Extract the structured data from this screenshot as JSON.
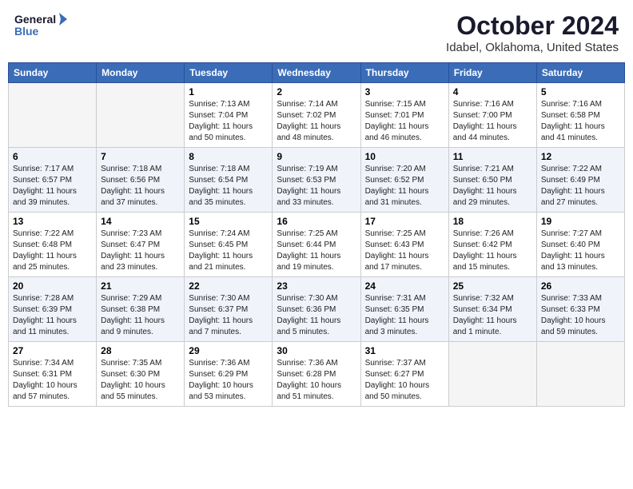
{
  "header": {
    "logo_line1": "General",
    "logo_line2": "Blue",
    "month": "October 2024",
    "location": "Idabel, Oklahoma, United States"
  },
  "weekdays": [
    "Sunday",
    "Monday",
    "Tuesday",
    "Wednesday",
    "Thursday",
    "Friday",
    "Saturday"
  ],
  "weeks": [
    [
      {
        "day": "",
        "info": ""
      },
      {
        "day": "",
        "info": ""
      },
      {
        "day": "1",
        "info": "Sunrise: 7:13 AM\nSunset: 7:04 PM\nDaylight: 11 hours and 50 minutes."
      },
      {
        "day": "2",
        "info": "Sunrise: 7:14 AM\nSunset: 7:02 PM\nDaylight: 11 hours and 48 minutes."
      },
      {
        "day": "3",
        "info": "Sunrise: 7:15 AM\nSunset: 7:01 PM\nDaylight: 11 hours and 46 minutes."
      },
      {
        "day": "4",
        "info": "Sunrise: 7:16 AM\nSunset: 7:00 PM\nDaylight: 11 hours and 44 minutes."
      },
      {
        "day": "5",
        "info": "Sunrise: 7:16 AM\nSunset: 6:58 PM\nDaylight: 11 hours and 41 minutes."
      }
    ],
    [
      {
        "day": "6",
        "info": "Sunrise: 7:17 AM\nSunset: 6:57 PM\nDaylight: 11 hours and 39 minutes."
      },
      {
        "day": "7",
        "info": "Sunrise: 7:18 AM\nSunset: 6:56 PM\nDaylight: 11 hours and 37 minutes."
      },
      {
        "day": "8",
        "info": "Sunrise: 7:18 AM\nSunset: 6:54 PM\nDaylight: 11 hours and 35 minutes."
      },
      {
        "day": "9",
        "info": "Sunrise: 7:19 AM\nSunset: 6:53 PM\nDaylight: 11 hours and 33 minutes."
      },
      {
        "day": "10",
        "info": "Sunrise: 7:20 AM\nSunset: 6:52 PM\nDaylight: 11 hours and 31 minutes."
      },
      {
        "day": "11",
        "info": "Sunrise: 7:21 AM\nSunset: 6:50 PM\nDaylight: 11 hours and 29 minutes."
      },
      {
        "day": "12",
        "info": "Sunrise: 7:22 AM\nSunset: 6:49 PM\nDaylight: 11 hours and 27 minutes."
      }
    ],
    [
      {
        "day": "13",
        "info": "Sunrise: 7:22 AM\nSunset: 6:48 PM\nDaylight: 11 hours and 25 minutes."
      },
      {
        "day": "14",
        "info": "Sunrise: 7:23 AM\nSunset: 6:47 PM\nDaylight: 11 hours and 23 minutes."
      },
      {
        "day": "15",
        "info": "Sunrise: 7:24 AM\nSunset: 6:45 PM\nDaylight: 11 hours and 21 minutes."
      },
      {
        "day": "16",
        "info": "Sunrise: 7:25 AM\nSunset: 6:44 PM\nDaylight: 11 hours and 19 minutes."
      },
      {
        "day": "17",
        "info": "Sunrise: 7:25 AM\nSunset: 6:43 PM\nDaylight: 11 hours and 17 minutes."
      },
      {
        "day": "18",
        "info": "Sunrise: 7:26 AM\nSunset: 6:42 PM\nDaylight: 11 hours and 15 minutes."
      },
      {
        "day": "19",
        "info": "Sunrise: 7:27 AM\nSunset: 6:40 PM\nDaylight: 11 hours and 13 minutes."
      }
    ],
    [
      {
        "day": "20",
        "info": "Sunrise: 7:28 AM\nSunset: 6:39 PM\nDaylight: 11 hours and 11 minutes."
      },
      {
        "day": "21",
        "info": "Sunrise: 7:29 AM\nSunset: 6:38 PM\nDaylight: 11 hours and 9 minutes."
      },
      {
        "day": "22",
        "info": "Sunrise: 7:30 AM\nSunset: 6:37 PM\nDaylight: 11 hours and 7 minutes."
      },
      {
        "day": "23",
        "info": "Sunrise: 7:30 AM\nSunset: 6:36 PM\nDaylight: 11 hours and 5 minutes."
      },
      {
        "day": "24",
        "info": "Sunrise: 7:31 AM\nSunset: 6:35 PM\nDaylight: 11 hours and 3 minutes."
      },
      {
        "day": "25",
        "info": "Sunrise: 7:32 AM\nSunset: 6:34 PM\nDaylight: 11 hours and 1 minute."
      },
      {
        "day": "26",
        "info": "Sunrise: 7:33 AM\nSunset: 6:33 PM\nDaylight: 10 hours and 59 minutes."
      }
    ],
    [
      {
        "day": "27",
        "info": "Sunrise: 7:34 AM\nSunset: 6:31 PM\nDaylight: 10 hours and 57 minutes."
      },
      {
        "day": "28",
        "info": "Sunrise: 7:35 AM\nSunset: 6:30 PM\nDaylight: 10 hours and 55 minutes."
      },
      {
        "day": "29",
        "info": "Sunrise: 7:36 AM\nSunset: 6:29 PM\nDaylight: 10 hours and 53 minutes."
      },
      {
        "day": "30",
        "info": "Sunrise: 7:36 AM\nSunset: 6:28 PM\nDaylight: 10 hours and 51 minutes."
      },
      {
        "day": "31",
        "info": "Sunrise: 7:37 AM\nSunset: 6:27 PM\nDaylight: 10 hours and 50 minutes."
      },
      {
        "day": "",
        "info": ""
      },
      {
        "day": "",
        "info": ""
      }
    ]
  ]
}
